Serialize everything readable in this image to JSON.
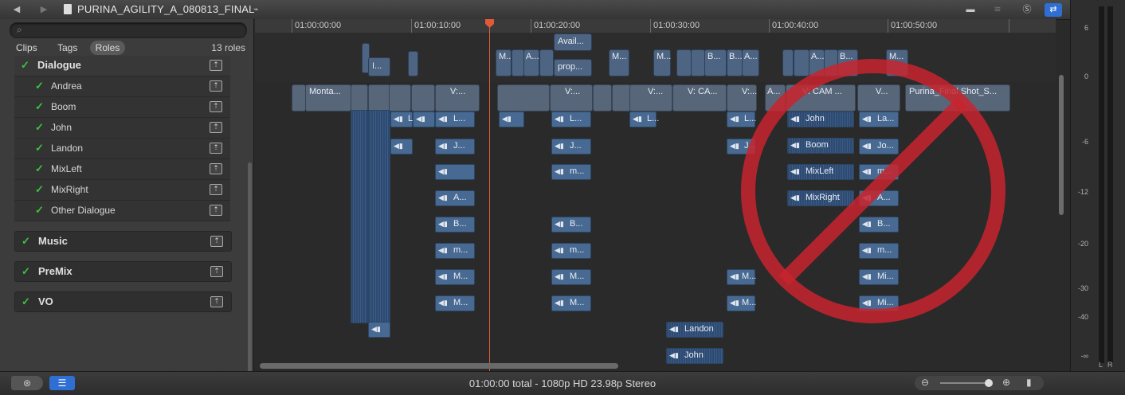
{
  "toolbar": {
    "back_icon": "triangle-left-icon",
    "forward_icon": "triangle-right-icon",
    "project_title": "PURINA_AGILITY_A_080813_FINAL"
  },
  "sidebar": {
    "search_placeholder": "",
    "tabs": {
      "clips": "Clips",
      "tags": "Tags",
      "roles": "Roles"
    },
    "roles_count": "13 roles",
    "roles": [
      {
        "label": "Dialogue",
        "checked": true,
        "subroles": [
          {
            "label": "Andrea"
          },
          {
            "label": "Boom"
          },
          {
            "label": "John"
          },
          {
            "label": "Landon"
          },
          {
            "label": "MixLeft"
          },
          {
            "label": "MixRight"
          },
          {
            "label": "Other Dialogue"
          }
        ]
      },
      {
        "label": "Music",
        "checked": true
      },
      {
        "label": "PreMix",
        "checked": true
      },
      {
        "label": "VO",
        "checked": true
      }
    ]
  },
  "timeline": {
    "timecodes": [
      "01:00:00:00",
      "01:00:10:00",
      "01:00:20:00",
      "01:00:30:00",
      "01:00:40:00",
      "01:00:50:00"
    ],
    "clips": {
      "c_monta": "Monta...",
      "c_avail": "Avail...",
      "c_prop": "prop...",
      "c_vcam1": "V: CAM ...",
      "c_vca": "V: CA...",
      "c_purina": "Purina_Final Shot_S...",
      "c_john": "John",
      "c_boom": "Boom",
      "c_mixleft": "MixLeft",
      "c_mixright": "MixRight",
      "c_landon": "Landon",
      "c_john2": "John",
      "c_m": "M...",
      "c_b": "B...",
      "c_a": "A...",
      "c_l": "L...",
      "c_j": "J...",
      "c_mix": "m...",
      "c_mi": "Mi...",
      "c_la": "La...",
      "c_jo": "Jo...",
      "c_v": "V:...",
      "c_i": "I...",
      "c_vdots": "V..."
    }
  },
  "meter": {
    "scale": [
      "6",
      "0",
      "-6",
      "-12",
      "-20",
      "-30",
      "-40",
      "-∞"
    ],
    "channels": [
      "L",
      "R"
    ]
  },
  "status": {
    "text": "01:00:00 total - 1080p HD 23.98p Stereo"
  },
  "overlay": {
    "symbol": "prohibition-sign",
    "color": "#c8242e"
  }
}
